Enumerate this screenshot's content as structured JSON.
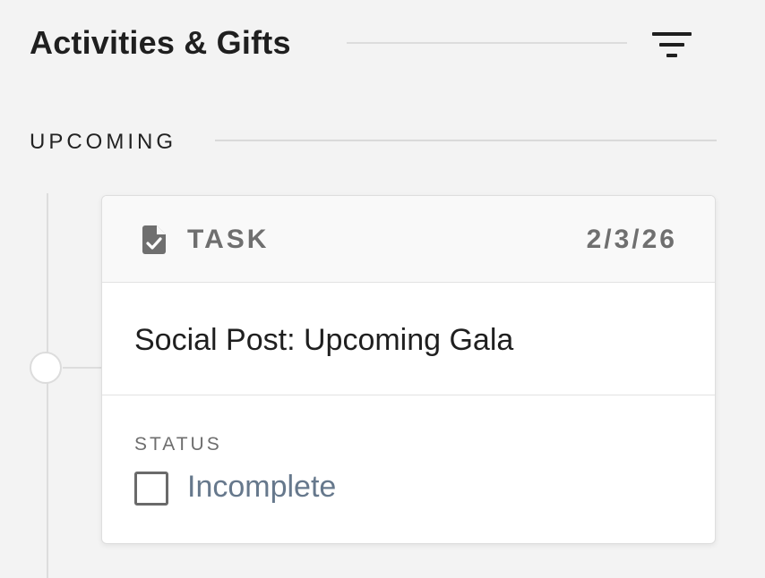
{
  "header": {
    "title": "Activities & Gifts",
    "filter_icon": "filter-icon"
  },
  "section": {
    "label": "UPCOMING"
  },
  "activity": {
    "type_icon": "task-file-check-icon",
    "type": "TASK",
    "date": "2/3/26",
    "title": "Social Post: Upcoming Gala",
    "status_label": "STATUS",
    "status_value": "Incomplete",
    "completed": false
  },
  "colors": {
    "background": "#f3f3f3",
    "heading_text": "#1f1f1f",
    "muted_text": "#6f6f6f",
    "status_link": "#66788c",
    "divider": "#dddddd"
  }
}
